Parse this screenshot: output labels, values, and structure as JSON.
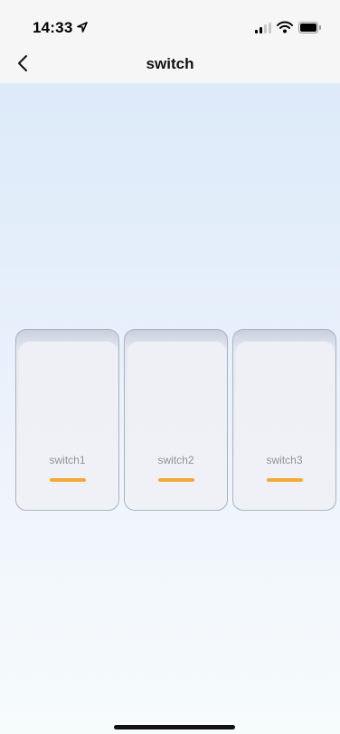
{
  "status_bar": {
    "time": "14:33",
    "icons": [
      "location-icon",
      "signal-icon",
      "wifi-icon",
      "battery-icon"
    ]
  },
  "nav": {
    "title": "switch",
    "back_icon": "chevron-left-icon"
  },
  "switches": [
    {
      "label": "switch1"
    },
    {
      "label": "switch2"
    },
    {
      "label": "switch3"
    }
  ],
  "colors": {
    "indicator": "#f4aa34",
    "background_top": "#ddeaf9",
    "background_bottom": "#f6fbfc",
    "label": "#8d929b"
  }
}
